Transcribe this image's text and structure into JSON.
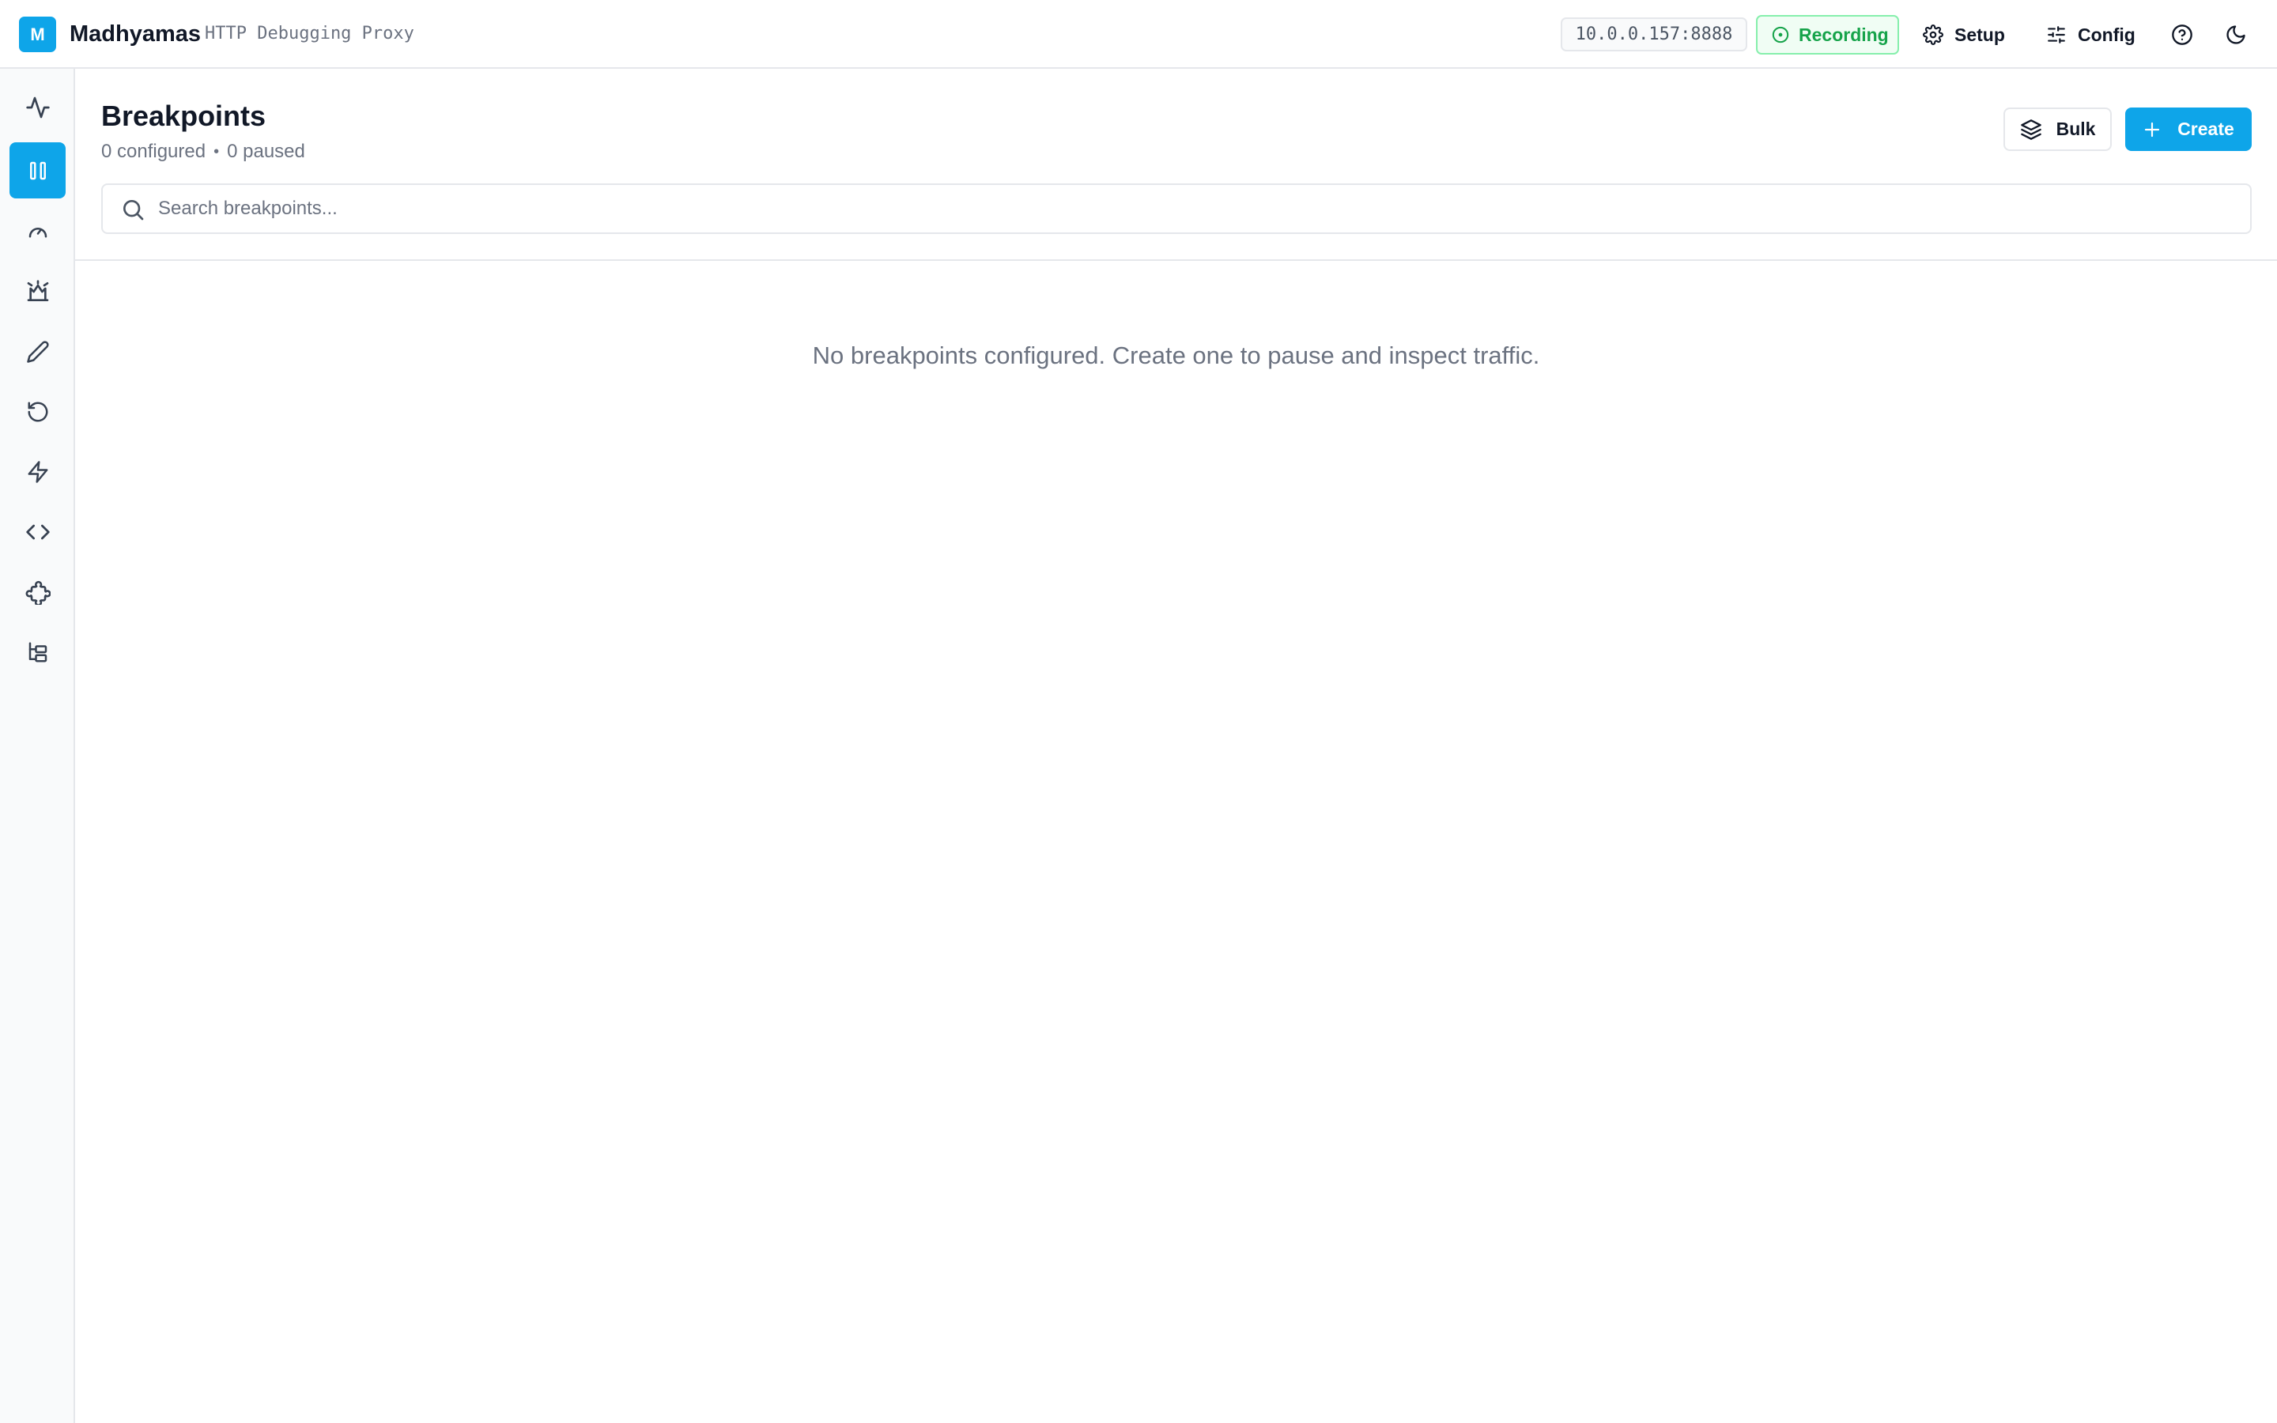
{
  "app": {
    "logo_letter": "M",
    "name": "Madhyamas",
    "subtitle": "HTTP Debugging Proxy"
  },
  "topbar": {
    "proxy_address": "10.0.0.157:8888",
    "recording_label": "Recording",
    "setup_label": "Setup",
    "config_label": "Config",
    "help_icon": "help-circle-icon",
    "theme_icon": "moon-icon",
    "recording_color": "#16a34a"
  },
  "sidebar": {
    "items": [
      {
        "icon": "activity-icon",
        "active": false
      },
      {
        "icon": "pause-icon",
        "active": true
      },
      {
        "icon": "gauge-icon",
        "active": false
      },
      {
        "icon": "map-rules-icon",
        "active": false
      },
      {
        "icon": "pencil-icon",
        "active": false
      },
      {
        "icon": "rotate-ccw-icon",
        "active": false
      },
      {
        "icon": "zap-icon",
        "active": false
      },
      {
        "icon": "code-icon",
        "active": false
      },
      {
        "icon": "puzzle-icon",
        "active": false
      },
      {
        "icon": "tree-icon",
        "active": false
      }
    ]
  },
  "main": {
    "title": "Breakpoints",
    "configured": "0 configured",
    "separator": "•",
    "paused": "0 paused",
    "bulk_label": "Bulk",
    "create_label": "Create",
    "search_placeholder": "Search breakpoints...",
    "empty_message": "No breakpoints configured. Create one to pause and inspect traffic."
  },
  "colors": {
    "accent": "#0ea5e9",
    "border": "#e5e7eb",
    "muted_text": "#6b7280"
  }
}
